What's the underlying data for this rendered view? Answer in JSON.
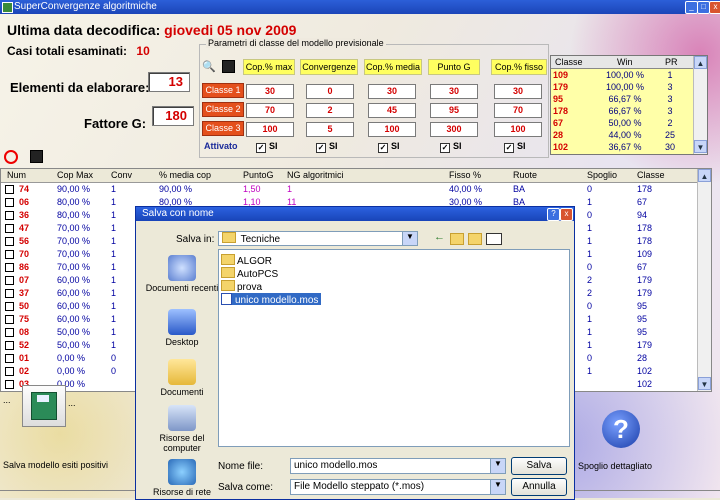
{
  "window": {
    "title": "SuperConvergenze algoritmiche",
    "controls": [
      "_",
      "□",
      "x"
    ]
  },
  "header": {
    "ultima_label": "Ultima data decodifica:",
    "ultima_value": "giovedi 05 nov 2009",
    "casi_label": "Casi totali esaminati:",
    "casi_value": "10",
    "elementi_label": "Elementi da elaborare:",
    "elementi_value": "13",
    "fattore_label": "Fattore G:",
    "fattore_value": "180"
  },
  "params": {
    "legend": "Parametri di classe del modello previsionale",
    "columns": [
      "Cop.% max",
      "Convergenze",
      "Cop.% media",
      "Punto G",
      "Cop.% fisso"
    ],
    "rows": [
      {
        "label": "Classe 1",
        "values": [
          "30",
          "0",
          "30",
          "30",
          "30"
        ]
      },
      {
        "label": "Classe 2",
        "values": [
          "70",
          "2",
          "45",
          "95",
          "70"
        ]
      },
      {
        "label": "Classe 3",
        "values": [
          "100",
          "5",
          "100",
          "300",
          "100"
        ]
      }
    ],
    "attivato_label": "Attivato",
    "checks": [
      "SI",
      "SI",
      "SI",
      "SI",
      "SI"
    ]
  },
  "classe_table": {
    "headers": [
      "Classe",
      "Win",
      "PR"
    ],
    "rows": [
      [
        "109",
        "100,00 %",
        "1"
      ],
      [
        "179",
        "100,00 %",
        "3"
      ],
      [
        "95",
        "66,67 %",
        "3"
      ],
      [
        "178",
        "66,67 %",
        "3"
      ],
      [
        "67",
        "50,00 %",
        "2"
      ],
      [
        "28",
        "44,00 %",
        "25"
      ],
      [
        "102",
        "36,67 %",
        "30"
      ]
    ]
  },
  "toolbar2": {
    "icons": [
      "no-icon",
      "save-icon"
    ]
  },
  "grid": {
    "headers": [
      "Num",
      "Cop Max",
      "Conv",
      "% media cop",
      "PuntoG",
      "NG algoritmici",
      "Fisso %",
      "Ruote",
      "Spoglio",
      "Classe"
    ],
    "rows": [
      [
        "74",
        "90,00 %",
        "1",
        "90,00 %",
        "1,50",
        "1",
        "40,00 %",
        "BA",
        "0",
        "178"
      ],
      [
        "06",
        "80,00 %",
        "1",
        "80,00 %",
        "1,10",
        "11",
        "30,00 %",
        "BA",
        "1",
        "67"
      ],
      [
        "36",
        "80,00 %",
        "1",
        "",
        "",
        "",
        "",
        "",
        "0",
        "94"
      ],
      [
        "47",
        "70,00 %",
        "1",
        "",
        "",
        "",
        "",
        "",
        "1",
        "178"
      ],
      [
        "56",
        "70,00 %",
        "1",
        "",
        "",
        "",
        "",
        "",
        "1",
        "178"
      ],
      [
        "70",
        "70,00 %",
        "1",
        "",
        "",
        "",
        "",
        "",
        "1",
        "109"
      ],
      [
        "86",
        "70,00 %",
        "1",
        "",
        "",
        "",
        "",
        "",
        "0",
        "67"
      ],
      [
        "07",
        "60,00 %",
        "1",
        "",
        "",
        "",
        "",
        "",
        "2",
        "179"
      ],
      [
        "37",
        "60,00 %",
        "1",
        "",
        "",
        "",
        "",
        "",
        "2",
        "179"
      ],
      [
        "50",
        "60,00 %",
        "1",
        "",
        "",
        "",
        "",
        "",
        "0",
        "95"
      ],
      [
        "75",
        "60,00 %",
        "1",
        "",
        "",
        "",
        "",
        "",
        "1",
        "95"
      ],
      [
        "08",
        "50,00 %",
        "1",
        "",
        "",
        "",
        "",
        "",
        "1",
        "95"
      ],
      [
        "52",
        "50,00 %",
        "1",
        "",
        "",
        "",
        "",
        "",
        "1",
        "179"
      ],
      [
        "01",
        "0,00 %",
        "0",
        "",
        "",
        "",
        "",
        "",
        "0",
        "28"
      ],
      [
        "02",
        "0,00 %",
        "0",
        "",
        "",
        "",
        "",
        "",
        "1",
        "102"
      ],
      [
        "03",
        "0,00 %",
        "",
        "",
        "",
        "",
        "",
        "",
        "",
        "102"
      ]
    ]
  },
  "dialog": {
    "title": "Salva con nome",
    "salva_in_label": "Salva in:",
    "salva_in_value": "Tecniche",
    "places": [
      "Documenti recenti",
      "Desktop",
      "Documenti",
      "Risorse del computer",
      "Risorse di rete"
    ],
    "files": [
      {
        "name": "ALGOR",
        "type": "folder"
      },
      {
        "name": "AutoPCS",
        "type": "folder"
      },
      {
        "name": "prova",
        "type": "folder"
      },
      {
        "name": "unico modello.mos",
        "type": "file"
      }
    ],
    "nome_file_label": "Nome file:",
    "nome_file_value": "unico modello.mos",
    "salva_come_label": "Salva come:",
    "salva_come_value": "File Modello steppato (*.mos)",
    "salva_button": "Salva",
    "annulla_button": "Annulla",
    "help_glyph": "?",
    "close_glyph": "x"
  },
  "bottom": {
    "dots_top": "...",
    "dots_btn": "...",
    "save_label": "Salva modello esiti positivi",
    "spoglio_label": "Spoglio dettagliato",
    "help_glyph": "?"
  },
  "colors": {
    "accent_red": "#d40000",
    "title_blue": "#1b45b8",
    "yellow": "#ffff60",
    "orange": "#e4501c"
  }
}
